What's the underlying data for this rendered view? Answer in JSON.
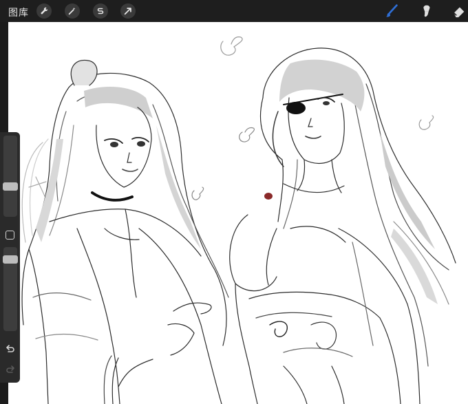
{
  "topbar": {
    "gallery_label": "图库",
    "left_tools": [
      "wrench-icon",
      "magic-wand-icon",
      "selection-icon",
      "transform-arrow-icon"
    ],
    "right_tools": [
      "brush-icon",
      "smudge-icon",
      "eraser-icon"
    ],
    "active_tool_color": "#2f6fd6"
  },
  "sidebar": {
    "size_slider_level": 0.48,
    "opacity_slider_level": 0.08,
    "buttons": [
      "modify-button",
      "undo-button",
      "redo-button"
    ]
  },
  "canvas": {
    "background": "#ffffff",
    "content": "sketch-artwork"
  }
}
